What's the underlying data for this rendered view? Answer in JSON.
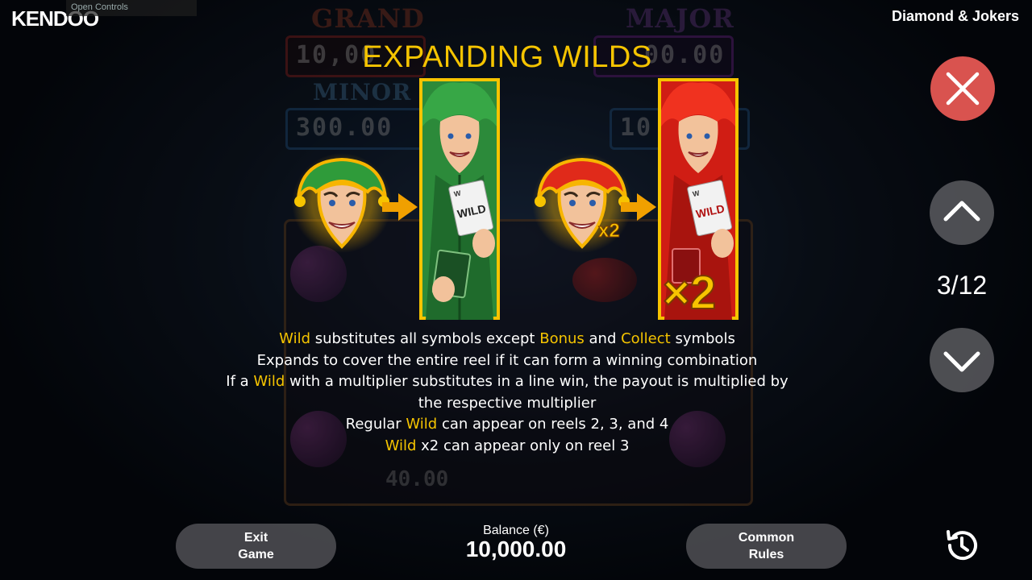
{
  "header": {
    "logo_text": "KENDOO",
    "open_controls_label": "Open Controls",
    "game_title": "Diamond & Jokers"
  },
  "background": {
    "jackpots": [
      {
        "title": "GRAND",
        "value": "10,00"
      },
      {
        "title": "MAJOR",
        "value": "00.00"
      },
      {
        "title": "MINOR",
        "value": "300.00"
      },
      {
        "title": "",
        "value": "10"
      }
    ],
    "reel_value": "40.00"
  },
  "page": {
    "heading": "EXPANDING WILDS",
    "card_word": "WILD",
    "card_corner": "W",
    "multiplier_small": "x2",
    "multiplier_large": "×2"
  },
  "rules": {
    "line1": {
      "w1": "Wild",
      "t1": " substitutes all symbols except ",
      "w2": "Bonus",
      "t2": " and ",
      "w3": "Collect",
      "t3": " symbols"
    },
    "line2": "Expands to cover the entire reel if it can form a winning combination",
    "line3": {
      "t1": "If a ",
      "w1": "Wild",
      "t2": " with a multiplier substitutes in a line win, the payout is multiplied by the respective multiplier"
    },
    "line4": {
      "t1": "Regular ",
      "w1": "Wild",
      "t2": " can appear on reels 2, 3, and 4"
    },
    "line5": {
      "w1": "Wild",
      "t1": " x2 can appear only on reel 3"
    }
  },
  "nav": {
    "page_indicator": "3/12",
    "current_page": 3,
    "total_pages": 12
  },
  "footer": {
    "exit_line1": "Exit",
    "exit_line2": "Game",
    "balance_label": "Balance (€)",
    "balance_value": "10,000.00",
    "rules_line1": "Common",
    "rules_line2": "Rules"
  },
  "colors": {
    "accent_yellow": "#f5c400",
    "close_red": "#d9534f",
    "button_gray": "#5a5a5f",
    "arrow_orange": "#f0a000"
  },
  "icons": [
    "close-icon",
    "chevron-up-icon",
    "chevron-down-icon",
    "history-icon"
  ]
}
